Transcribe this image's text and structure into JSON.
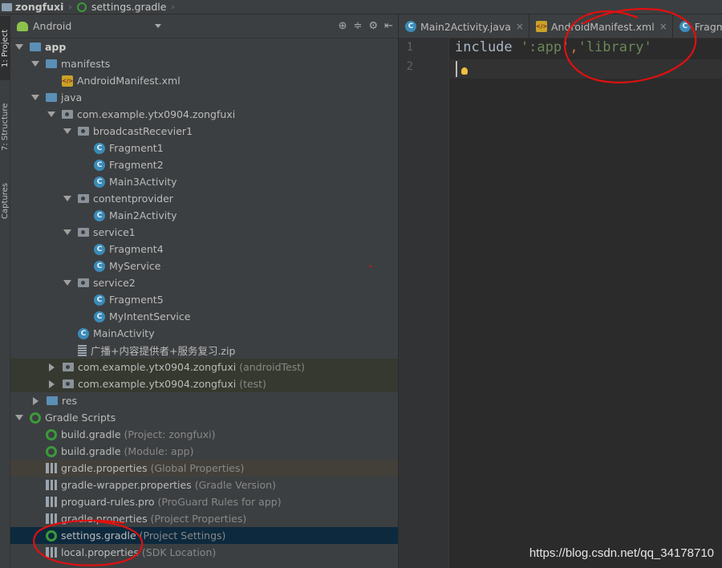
{
  "breadcrumb": {
    "project": "zongfuxi",
    "file": "settings.gradle"
  },
  "left_strip": {
    "tab1": "1: Project",
    "tab2": "7: Structure",
    "tab3": "Captures"
  },
  "panel": {
    "view_mode": "Android"
  },
  "tree": [
    {
      "label": "app",
      "icon": "folder-blue",
      "arrow": "down",
      "bold": true
    },
    {
      "label": "manifests",
      "icon": "folder-blue",
      "arrow": "down"
    },
    {
      "label": "AndroidManifest.xml",
      "icon": "xml"
    },
    {
      "label": "java",
      "icon": "folder-blue",
      "arrow": "down"
    },
    {
      "label": "com.example.ytx0904.zongfuxi",
      "icon": "folder-gray",
      "arrow": "down"
    },
    {
      "label": "broadcastRecevier1",
      "icon": "folder-gray",
      "arrow": "down"
    },
    {
      "label": "Fragment1",
      "icon": "class-c"
    },
    {
      "label": "Fragment2",
      "icon": "class-c"
    },
    {
      "label": "Main3Activity",
      "icon": "class-c"
    },
    {
      "label": "contentprovider",
      "icon": "folder-gray",
      "arrow": "down"
    },
    {
      "label": "Main2Activity",
      "icon": "class-c"
    },
    {
      "label": "service1",
      "icon": "folder-gray",
      "arrow": "down"
    },
    {
      "label": "Fragment4",
      "icon": "class-c"
    },
    {
      "label": "MyService",
      "icon": "class-c"
    },
    {
      "label": "service2",
      "icon": "folder-gray",
      "arrow": "down"
    },
    {
      "label": "Fragment5",
      "icon": "class-c"
    },
    {
      "label": "MyIntentService",
      "icon": "class-c"
    },
    {
      "label": "MainActivity",
      "icon": "class-c"
    },
    {
      "label": "广播+内容提供者+服务复习.zip",
      "icon": "zip"
    },
    {
      "label": "com.example.ytx0904.zongfuxi",
      "hint": "(androidTest)",
      "icon": "folder-gray",
      "arrow": "right"
    },
    {
      "label": "com.example.ytx0904.zongfuxi",
      "hint": "(test)",
      "icon": "folder-gray",
      "arrow": "right"
    },
    {
      "label": "res",
      "icon": "folder-blue",
      "arrow": "right"
    },
    {
      "label": "Gradle Scripts",
      "icon": "gradle-main",
      "arrow": "down"
    },
    {
      "label": "build.gradle",
      "hint": "(Project: zongfuxi)",
      "icon": "gradle"
    },
    {
      "label": "build.gradle",
      "hint": "(Module: app)",
      "icon": "gradle"
    },
    {
      "label": "gradle.properties",
      "hint": "(Global Properties)",
      "icon": "props"
    },
    {
      "label": "gradle-wrapper.properties",
      "hint": "(Gradle Version)",
      "icon": "props"
    },
    {
      "label": "proguard-rules.pro",
      "hint": "(ProGuard Rules for app)",
      "icon": "props"
    },
    {
      "label": "gradle.properties",
      "hint": "(Project Properties)",
      "icon": "props"
    },
    {
      "label": "settings.gradle",
      "hint": "(Project Settings)",
      "icon": "gradle"
    },
    {
      "label": "local.properties",
      "hint": "(SDK Location)",
      "icon": "props"
    }
  ],
  "tabs": [
    {
      "label": "Main2Activity.java",
      "icon": "class-c"
    },
    {
      "label": "AndroidManifest.xml",
      "icon": "xml"
    },
    {
      "label": "Fragment",
      "icon": "class-c"
    }
  ],
  "editor": {
    "line_numbers": [
      "1",
      "2"
    ],
    "code": {
      "keyword": "include",
      "arg1": "':app'",
      "comma": ",",
      "arg2": "'library'"
    }
  },
  "watermark": "https://blog.csdn.net/qq_34178710",
  "colors": {
    "annotation": "#e01010",
    "selection": "#0d293e"
  }
}
